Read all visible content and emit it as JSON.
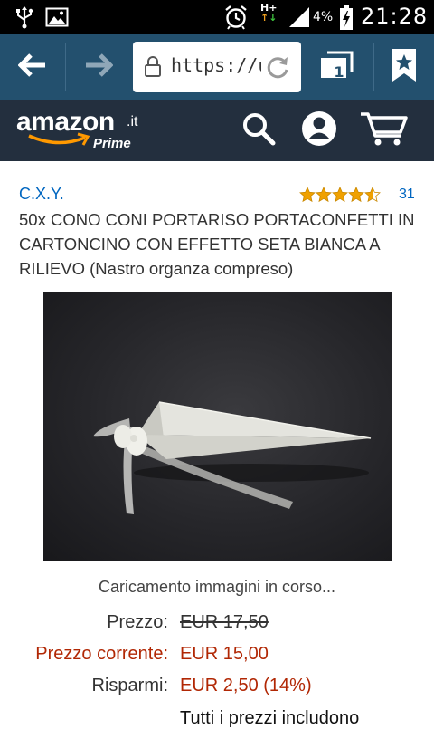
{
  "status_bar": {
    "network": "H+",
    "battery": "4%",
    "time": "21:28"
  },
  "browser": {
    "url": "https://u",
    "tab_count": "1",
    "icons": [
      "back-arrow-icon",
      "forward-arrow-icon",
      "lock-icon",
      "refresh-icon",
      "tabs-icon",
      "bookmark-star-icon"
    ]
  },
  "amazon": {
    "logo_text": "amazon",
    "logo_tld": ".it",
    "prime_text": "Prime",
    "icons": [
      "search-icon",
      "account-icon",
      "cart-icon"
    ],
    "brand_color": "#232f3e",
    "accent_color": "#ff9900"
  },
  "product": {
    "brand": "C.X.Y.",
    "rating": 4.5,
    "review_count": "31",
    "title": "50x CONO CONI PORTARISO PORTACONFETTI IN CARTONCINO CON EFFETTO SETA BIANCA A RILIEVO (Nastro organza compreso)",
    "image_loading_text": "Caricamento immagini in corso..."
  },
  "pricing": {
    "list_price_label": "Prezzo:",
    "list_price": "EUR 17,50",
    "current_price_label": "Prezzo corrente:",
    "current_price": "EUR 15,00",
    "savings_label": "Risparmi:",
    "savings": "EUR 2,50 (14%)",
    "tax_note": "Tutti i prezzi includono",
    "price_color": "#b12704"
  }
}
